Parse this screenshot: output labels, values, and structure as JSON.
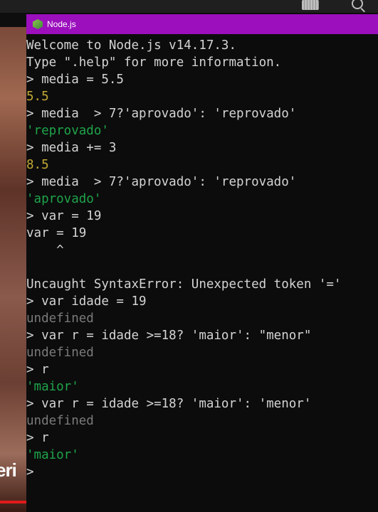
{
  "window": {
    "title": "Node.js",
    "icon": "nodejs-icon"
  },
  "background": {
    "partial_text": "eri",
    "accent_color": "#e21a1a"
  },
  "colors": {
    "titlebar": "#9b0fbd",
    "terminal_bg": "#0c0c0c",
    "text": "#d4d4d4",
    "number": "#c3a935",
    "string": "#1fa44a",
    "undefined": "#7a7a7a"
  },
  "terminal": {
    "lines": [
      {
        "text": "Welcome to Node.js v14.17.3.",
        "kind": "default"
      },
      {
        "text": "Type \".help\" for more information.",
        "kind": "default"
      },
      {
        "text": "> media = 5.5",
        "kind": "default"
      },
      {
        "text": "5.5",
        "kind": "number"
      },
      {
        "text": "> media  > 7?'aprovado': 'reprovado'",
        "kind": "default"
      },
      {
        "text": "'reprovado'",
        "kind": "string"
      },
      {
        "text": "> media += 3",
        "kind": "default"
      },
      {
        "text": "8.5",
        "kind": "number"
      },
      {
        "text": "> media  > 7?'aprovado': 'reprovado'",
        "kind": "default"
      },
      {
        "text": "'aprovado'",
        "kind": "string"
      },
      {
        "text": "> var = 19",
        "kind": "default"
      },
      {
        "text": "var = 19",
        "kind": "default"
      },
      {
        "text": "    ^",
        "kind": "default"
      },
      {
        "text": "",
        "kind": "default"
      },
      {
        "text": "Uncaught SyntaxError: Unexpected token '='",
        "kind": "default"
      },
      {
        "text": "> var idade = 19",
        "kind": "default"
      },
      {
        "text": "undefined",
        "kind": "undef"
      },
      {
        "text": "> var r = idade >=18? 'maior': \"menor\"",
        "kind": "default"
      },
      {
        "text": "undefined",
        "kind": "undef"
      },
      {
        "text": "> r",
        "kind": "default"
      },
      {
        "text": "'maior'",
        "kind": "string"
      },
      {
        "text": "> var r = idade >=18? 'maior': 'menor'",
        "kind": "default"
      },
      {
        "text": "undefined",
        "kind": "undef"
      },
      {
        "text": "> r",
        "kind": "default"
      },
      {
        "text": "'maior'",
        "kind": "string"
      },
      {
        "text": ">",
        "kind": "default"
      }
    ]
  }
}
